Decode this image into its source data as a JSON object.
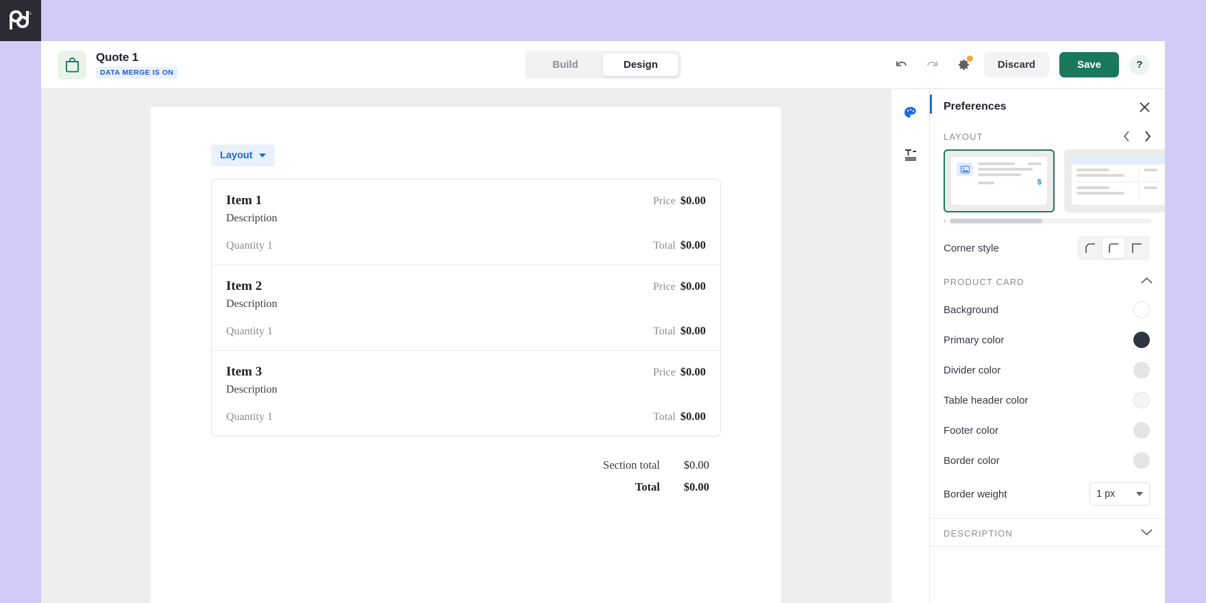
{
  "logo": {
    "name": "pd",
    "trademark": "®"
  },
  "topbar": {
    "doc_icon": "shopping-bag-icon",
    "title": "Quote 1",
    "badge": "DATA MERGE IS ON",
    "tabs": [
      {
        "label": "Build",
        "active": false
      },
      {
        "label": "Design",
        "active": true
      }
    ],
    "undo": "undo-icon",
    "redo": "redo-icon",
    "settings": "gear-icon",
    "discard_label": "Discard",
    "save_label": "Save",
    "help_label": "?",
    "save_color": "#19795a",
    "notification_color": "#f9a03c"
  },
  "canvas": {
    "layout_pill": "Layout",
    "items": [
      {
        "name": "Item 1",
        "description": "Description",
        "price_label": "Price",
        "price_value": "$0.00",
        "qty_label": "Quantity 1",
        "total_label": "Total",
        "total_value": "$0.00"
      },
      {
        "name": "Item 2",
        "description": "Description",
        "price_label": "Price",
        "price_value": "$0.00",
        "qty_label": "Quantity 1",
        "total_label": "Total",
        "total_value": "$0.00"
      },
      {
        "name": "Item 3",
        "description": "Description",
        "price_label": "Price",
        "price_value": "$0.00",
        "qty_label": "Quantity 1",
        "total_label": "Total",
        "total_value": "$0.00"
      }
    ],
    "section_total_label": "Section total",
    "section_total_value": "$0.00",
    "grand_total_label": "Total",
    "grand_total_value": "$0.00"
  },
  "rail": [
    {
      "icon": "palette-icon",
      "active": true
    },
    {
      "icon": "text-style-icon",
      "active": false
    }
  ],
  "prefs": {
    "title": "Preferences",
    "close": "close-icon",
    "layout": {
      "title": "LAYOUT",
      "prev": "chevron-left-icon",
      "next": "chevron-right-icon",
      "thumbs": [
        {
          "name": "card-layout",
          "selected": true
        },
        {
          "name": "table-layout",
          "selected": false
        }
      ]
    },
    "corner_style": {
      "label": "Corner style",
      "options": [
        {
          "name": "rounded",
          "active": false
        },
        {
          "name": "semi-rounded",
          "active": true
        },
        {
          "name": "sharp",
          "active": false
        }
      ]
    },
    "product_card": {
      "title": "PRODUCT CARD",
      "toggle": "chevron-up-icon",
      "rows": [
        {
          "label": "Background",
          "color": "#ffffff"
        },
        {
          "label": "Primary color",
          "color": "#2f3540"
        },
        {
          "label": "Divider color",
          "color": "#e4e4e6"
        },
        {
          "label": "Table header color",
          "color": "#f5f5f6"
        },
        {
          "label": "Footer color",
          "color": "#e4e4e6"
        },
        {
          "label": "Border color",
          "color": "#e4e4e6"
        }
      ],
      "border_weight_label": "Border weight",
      "border_weight_value": "1 px"
    },
    "description": {
      "title": "DESCRIPTION",
      "toggle": "chevron-down-icon"
    }
  }
}
